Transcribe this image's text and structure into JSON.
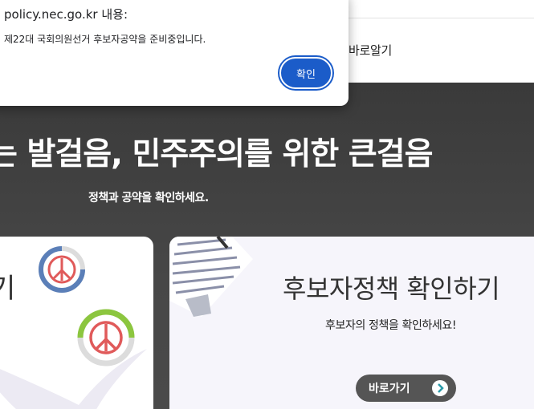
{
  "header": {
    "nav_item": "바로알기"
  },
  "hero": {
    "title": "는 발걸음, 민주주의를 위한 큰걸음",
    "subtitle": "정책과 공약을 확인하세요."
  },
  "card_left": {
    "title_fragment": "기"
  },
  "card_right": {
    "title": "후보자정책 확인하기",
    "subtitle": "후보자의 정책을 확인하세요!",
    "button_label": "바로가기"
  },
  "dialog": {
    "origin": "policy.nec.go.kr 내용:",
    "message": "제22대 국회의원선거 후보자공약을 준비중입니다.",
    "ok_label": "확인"
  },
  "colors": {
    "dialog_button": "#1b5cc9",
    "hero_background": "#3b3b3b",
    "stamp_red": "#e05a5a",
    "stamp_blue_ring": "#5b7fb8",
    "stamp_green_ring": "#8cc63f"
  }
}
